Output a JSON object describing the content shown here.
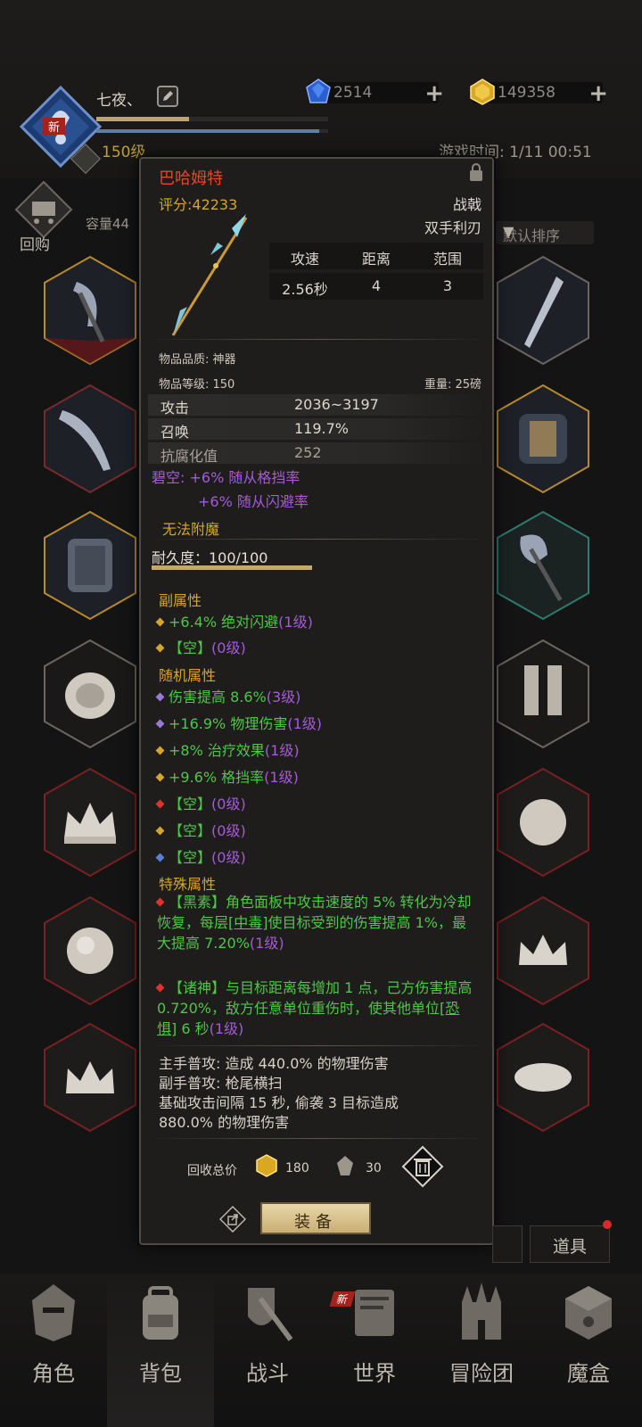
{
  "header": {
    "nickname": "七夜、",
    "level": "150级",
    "new_badge": "新",
    "game_time": "游戏时间: 1/11 00:51",
    "currency_blue": "2514",
    "currency_gold": "149358",
    "buyback_label": "回购",
    "capacity_label": "容量44",
    "sort_label": "默认排序"
  },
  "tooltip": {
    "name": "巴哈姆特",
    "score": "评分:42233",
    "type": "战戟",
    "subtype": "双手利刃",
    "stats_headers": [
      "攻速",
      "距离",
      "范围"
    ],
    "stats_values": [
      "2.56秒",
      "4",
      "3"
    ],
    "quality": "物品品质: 神器",
    "item_level": "物品等级: 150",
    "weight": "重量: 25磅",
    "attrs": [
      {
        "key": "攻击",
        "val": "2036~3197"
      },
      {
        "key": "召唤",
        "val": "119.7%"
      },
      {
        "key": "抗腐化值",
        "val": "252"
      }
    ],
    "set_line1": "碧空: +6% 随从格挡率",
    "set_line2": "+6% 随从闪避率",
    "no_enchant": "无法附魔",
    "durability": "耐久度：100/100",
    "durability_fraction": 1.0,
    "secondary_title": "副属性",
    "secondary": [
      {
        "text": "+6.4% 绝对闪避",
        "lvl": "(1级)",
        "color": "#d4a52f"
      },
      {
        "text": "【空】",
        "lvl": "(0级)",
        "color": "#d4a52f"
      }
    ],
    "random_title": "随机属性",
    "random": [
      {
        "text": "伤害提高 8.6%",
        "lvl": "(3级)",
        "color": "#9a78d6"
      },
      {
        "text": "+16.9% 物理伤害",
        "lvl": "(1级)",
        "color": "#9a78d6"
      },
      {
        "text": "+8% 治疗效果",
        "lvl": "(1级)",
        "color": "#d4a52f"
      },
      {
        "text": "+9.6% 格挡率",
        "lvl": "(1级)",
        "color": "#d4a52f"
      },
      {
        "text": "【空】",
        "lvl": "(0级)",
        "color": "#e0342a"
      },
      {
        "text": "【空】",
        "lvl": "(0级)",
        "color": "#d4a52f"
      },
      {
        "text": "【空】",
        "lvl": "(0级)",
        "color": "#5a7fd8"
      }
    ],
    "special_title": "特殊属性",
    "special1_a": "【黑素】角色面板中攻击速度的 5% 转化为冷却恢复，每层",
    "special1_link": "[中毒]",
    "special1_b": "使目标受到的伤害提高 1%，最大提高 7.20%",
    "special1_lvl": "(1级)",
    "special2_a": "【诸神】与目标距离每增加 1 点，己方伤害提高 0.720%，敌方任意单位重伤时，使其他单位",
    "special2_link": "[恐惧]",
    "special2_b": " 6 秒",
    "special2_lvl": "(1级)",
    "desc_lines": [
      "主手普攻: 造成 440.0% 的物理伤害",
      "副手普攻: 枪尾横扫",
      "基础攻击间隔 15 秒, 偷袭 3 目标造成",
      "880.0% 的物理伤害"
    ],
    "recycle_label": "回收总价",
    "recycle_gold": "180",
    "recycle_material": "30",
    "equip_label": "装备"
  },
  "bottom": {
    "props_label": "道具",
    "nav": [
      "角色",
      "背包",
      "战斗",
      "世界",
      "冒险团",
      "魔盒"
    ],
    "nav_new_badge": "新"
  }
}
